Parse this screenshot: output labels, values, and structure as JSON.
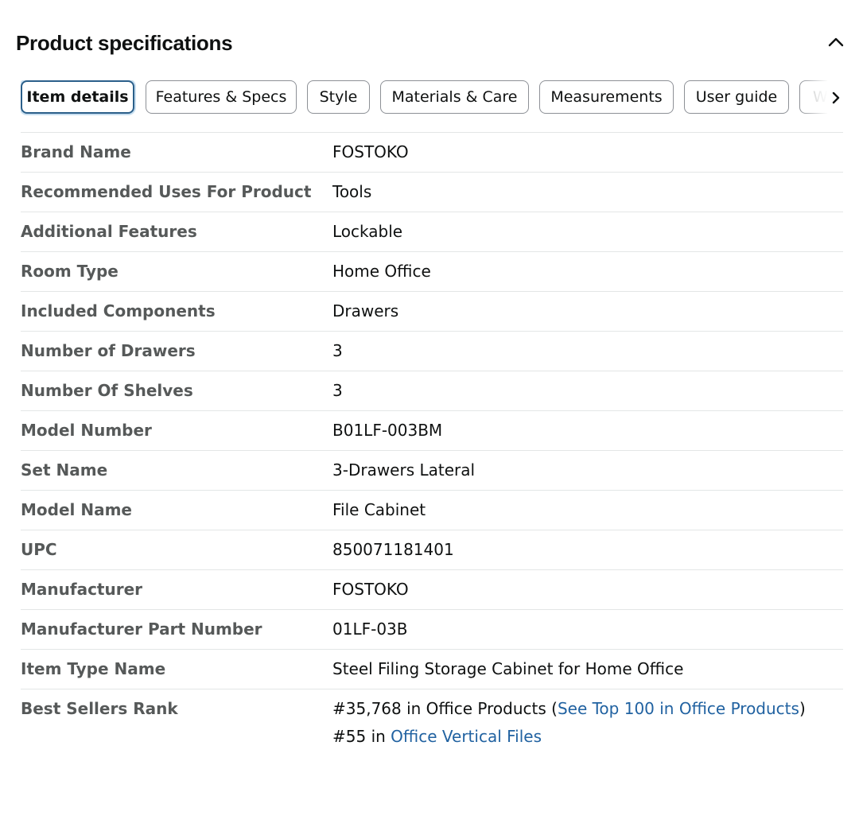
{
  "header": {
    "title": "Product specifications"
  },
  "tabs": [
    {
      "label": "Item details",
      "active": true
    },
    {
      "label": "Features & Specs",
      "active": false
    },
    {
      "label": "Style",
      "active": false
    },
    {
      "label": "Materials & Care",
      "active": false
    },
    {
      "label": "Measurements",
      "active": false
    },
    {
      "label": "User guide",
      "active": false
    },
    {
      "label": "Wa",
      "active": false
    }
  ],
  "specs": [
    {
      "label": "Brand Name",
      "value": "FOSTOKO"
    },
    {
      "label": "Recommended Uses For Product",
      "value": "Tools"
    },
    {
      "label": "Additional Features",
      "value": "Lockable"
    },
    {
      "label": "Room Type",
      "value": "Home Office"
    },
    {
      "label": "Included Components",
      "value": "Drawers"
    },
    {
      "label": "Number of Drawers",
      "value": "3"
    },
    {
      "label": "Number Of Shelves",
      "value": "3"
    },
    {
      "label": "Model Number",
      "value": "B01LF-003BM"
    },
    {
      "label": "Set Name",
      "value": "3-Drawers Lateral"
    },
    {
      "label": "Model Name",
      "value": "File Cabinet"
    },
    {
      "label": "UPC",
      "value": "850071181401"
    },
    {
      "label": "Manufacturer",
      "value": "FOSTOKO"
    },
    {
      "label": "Manufacturer Part Number",
      "value": "01LF-03B"
    },
    {
      "label": "Item Type Name",
      "value": "Steel Filing Storage Cabinet for Home Office"
    }
  ],
  "best_sellers": {
    "label": "Best Sellers Rank",
    "rank1_text": "#35,768 in Office Products (",
    "rank1_link": "See Top 100 in Office Products",
    "rank1_close": ")",
    "rank2_prefix": "#55 in ",
    "rank2_link": "Office Vertical Files"
  },
  "colors": {
    "link": "#2162a1",
    "active_tab_border": "#2b5f8a",
    "label_text": "#565959"
  },
  "icons": {
    "collapse": "chevron-up-icon",
    "tabs_next": "chevron-right-icon"
  }
}
